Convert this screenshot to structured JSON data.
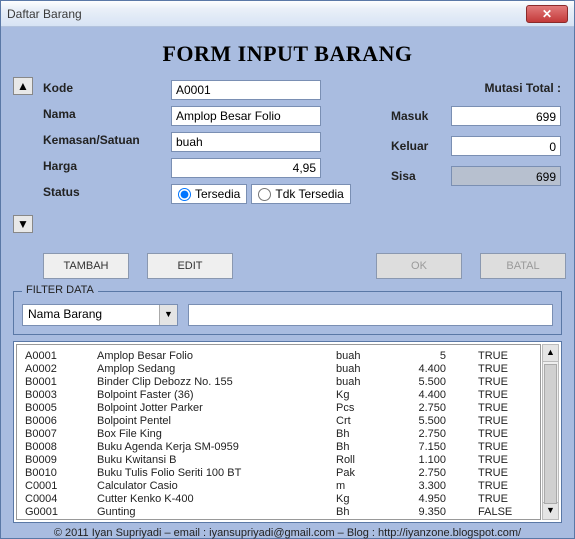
{
  "window": {
    "title": "Daftar Barang",
    "close_glyph": "✕"
  },
  "header": {
    "title": "FORM INPUT BARANG"
  },
  "form": {
    "labels": {
      "kode": "Kode",
      "nama": "Nama",
      "kemasan": "Kemasan/Satuan",
      "harga": "Harga",
      "status": "Status"
    },
    "values": {
      "kode": "A0001",
      "nama": "Amplop Besar Folio",
      "kemasan": "buah",
      "harga": "4,95"
    },
    "status": {
      "opt1": "Tersedia",
      "opt2": "Tdk Tersedia"
    }
  },
  "mutasi": {
    "title": "Mutasi Total :",
    "masuk_lbl": "Masuk",
    "masuk_val": "699",
    "keluar_lbl": "Keluar",
    "keluar_val": "0",
    "sisa_lbl": "Sisa",
    "sisa_val": "699"
  },
  "buttons": {
    "tambah": "TAMBAH",
    "edit": "EDIT",
    "ok": "OK",
    "batal": "BATAL"
  },
  "filter": {
    "legend": "FILTER DATA",
    "combo": "Nama Barang",
    "text": ""
  },
  "scroll": {
    "up": "▲",
    "down": "▼"
  },
  "list": [
    {
      "kode": "A0001",
      "nama": "Amplop Besar Folio",
      "sat": "buah",
      "harga": "5",
      "st": "TRUE"
    },
    {
      "kode": "A0002",
      "nama": "Amplop Sedang",
      "sat": "buah",
      "harga": "4.400",
      "st": "TRUE"
    },
    {
      "kode": "B0001",
      "nama": "Binder Clip Debozz No. 155",
      "sat": "buah",
      "harga": "5.500",
      "st": "TRUE"
    },
    {
      "kode": "B0003",
      "nama": "Bolpoint Faster (36)",
      "sat": "Kg",
      "harga": "4.400",
      "st": "TRUE"
    },
    {
      "kode": "B0005",
      "nama": "Bolpoint Jotter Parker",
      "sat": "Pcs",
      "harga": "2.750",
      "st": "TRUE"
    },
    {
      "kode": "B0006",
      "nama": "Bolpoint Pentel",
      "sat": "Crt",
      "harga": "5.500",
      "st": "TRUE"
    },
    {
      "kode": "B0007",
      "nama": "Box File King",
      "sat": "Bh",
      "harga": "2.750",
      "st": "TRUE"
    },
    {
      "kode": "B0008",
      "nama": "Buku Agenda Kerja SM-0959",
      "sat": "Bh",
      "harga": "7.150",
      "st": "TRUE"
    },
    {
      "kode": "B0009",
      "nama": "Buku Kwitansi B",
      "sat": "Roll",
      "harga": "1.100",
      "st": "TRUE"
    },
    {
      "kode": "B0010",
      "nama": "Buku Tulis Folio Seriti 100 BT",
      "sat": "Pak",
      "harga": "2.750",
      "st": "TRUE"
    },
    {
      "kode": "C0001",
      "nama": "Calculator Casio",
      "sat": "m",
      "harga": "3.300",
      "st": "TRUE"
    },
    {
      "kode": "C0004",
      "nama": "Cutter Kenko K-400",
      "sat": "Kg",
      "harga": "4.950",
      "st": "TRUE"
    },
    {
      "kode": "G0001",
      "nama": "Gunting",
      "sat": "Bh",
      "harga": "9.350",
      "st": "FALSE"
    }
  ],
  "footer": {
    "text": "© 2011 Iyan Supriyadi – email : iyansupriyadi@gmail.com – Blog : http://iyanzone.blogspot.com/"
  }
}
